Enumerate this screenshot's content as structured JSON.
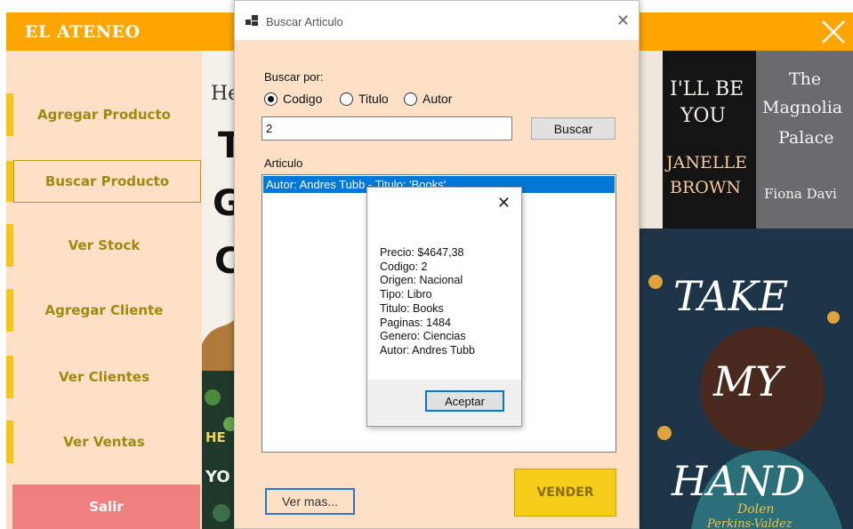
{
  "app": {
    "brand": "EL ATENEO",
    "nav": [
      {
        "label": "Agregar Producto"
      },
      {
        "label": "Buscar Producto"
      },
      {
        "label": "Ver Stock"
      },
      {
        "label": "Agregar Cliente"
      },
      {
        "label": "Ver Clientes"
      },
      {
        "label": "Ver Ventas"
      }
    ],
    "exit_label": "Salir",
    "book_covers": [
      {
        "lines": [
          "I'LL BE",
          "YOU",
          "JANELLE",
          "BROWN"
        ]
      },
      {
        "lines": [
          "The",
          "Magnolia",
          "Palace",
          "Fiona Davi"
        ]
      },
      {
        "lines": [
          "TAKE",
          "MY",
          "HAND",
          "Dolen",
          "Perkins-Valdez"
        ]
      },
      {
        "lines": [
          "He",
          "T",
          "G",
          "C",
          "HE",
          "YO"
        ]
      }
    ]
  },
  "dialog": {
    "title": "Buscar Articulo",
    "search_by_label": "Buscar por:",
    "options": [
      {
        "label": "Codigo",
        "checked": true
      },
      {
        "label": "Titulo",
        "checked": false
      },
      {
        "label": "Autor",
        "checked": false
      }
    ],
    "search_value": "2",
    "search_button": "Buscar",
    "list_label": "Articulo",
    "list_items": [
      "Autor: Andres Tubb - Titulo: 'Books'"
    ],
    "more_button": "Ver mas...",
    "sell_button": "VENDER"
  },
  "message_box": {
    "lines": [
      "Precio: $4647,38",
      "Codigo: 2",
      "Origen: Nacional",
      "Tipo: Libro",
      "Titulo: Books",
      "Paginas: 1484",
      "Genero: Ciencias",
      "Autor: Andres Tubb"
    ],
    "ok_button": "Aceptar"
  },
  "colors": {
    "header": "#ffa500",
    "background": "#fde0c5",
    "nav_text": "#a0890f",
    "nav_accent": "#f5c518",
    "exit_button": "#f08080",
    "sell_button": "#f5cd1a",
    "selection": "#0078d7"
  }
}
